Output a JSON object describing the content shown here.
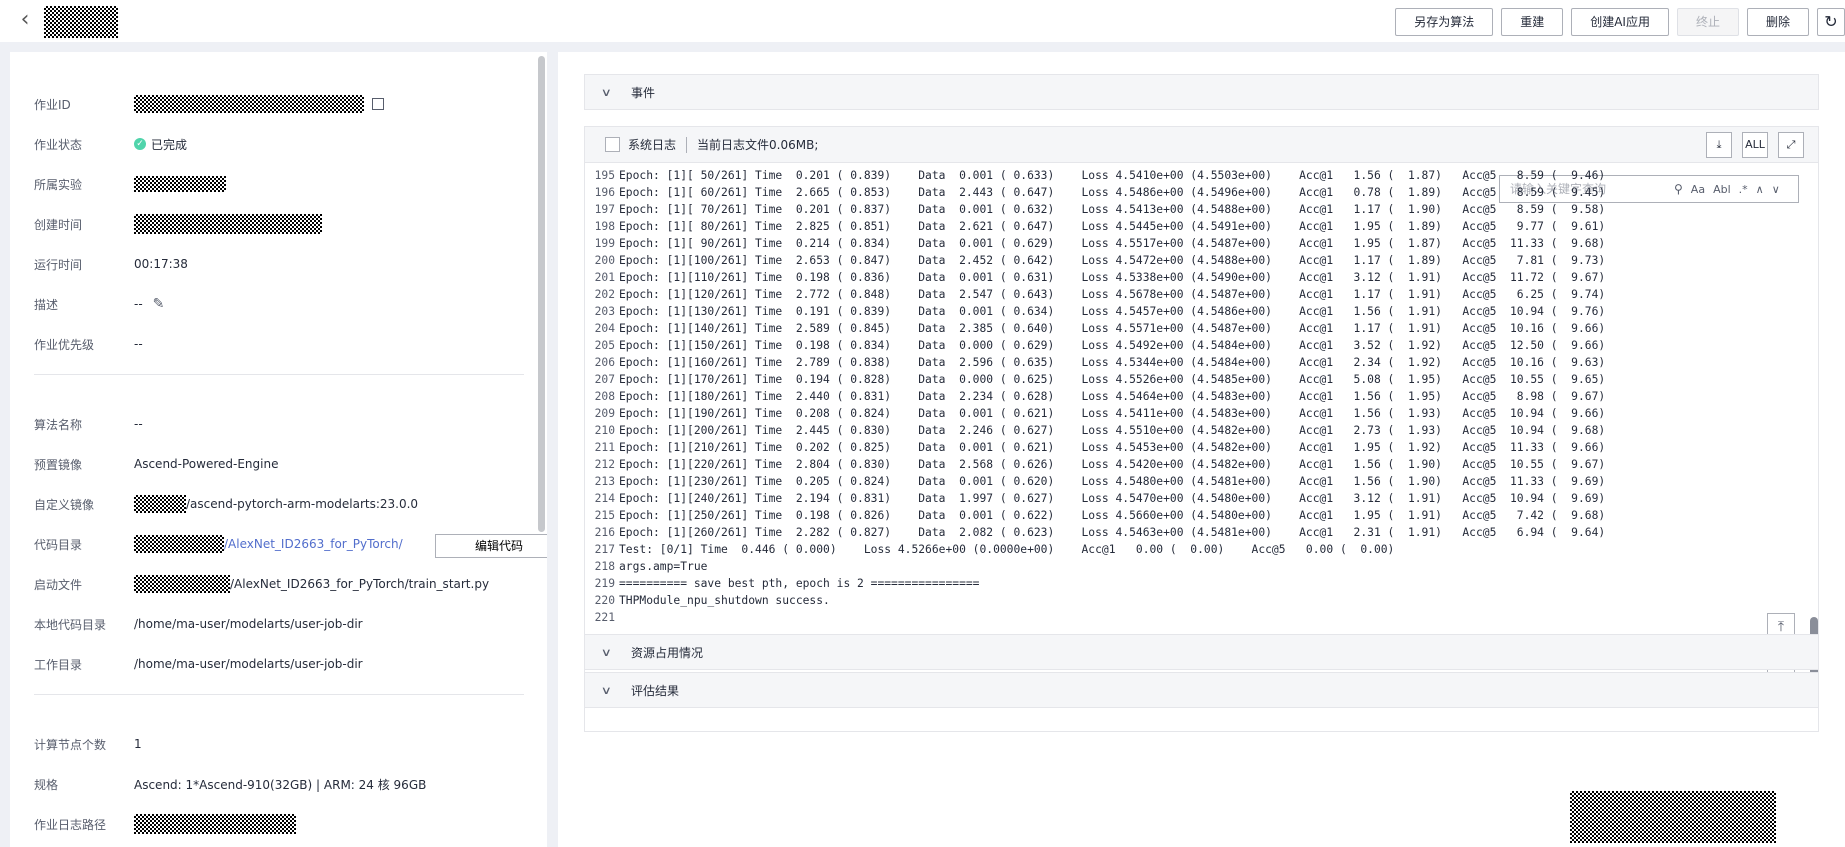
{
  "header": {
    "back_icon": "chevron-left-icon",
    "actions": {
      "save_as_algorithm": "另存为算法",
      "rebuild": "重建",
      "create_ai_app": "创建AI应用",
      "terminate": "终止",
      "delete": "删除",
      "refresh_icon": "refresh-icon"
    }
  },
  "job_info": {
    "job_id": {
      "label": "作业ID"
    },
    "status": {
      "label": "作业状态",
      "value": "已完成",
      "color": "#50d4ab"
    },
    "experiment": {
      "label": "所属实验"
    },
    "created_time": {
      "label": "创建时间"
    },
    "run_time": {
      "label": "运行时间",
      "value": "00:17:38"
    },
    "description": {
      "label": "描述",
      "value": "--"
    },
    "priority": {
      "label": "作业优先级",
      "value": "--"
    },
    "algorithm_name": {
      "label": "算法名称",
      "value": "--"
    },
    "preset_image": {
      "label": "预置镜像",
      "value": "Ascend-Powered-Engine"
    },
    "custom_image": {
      "label": "自定义镜像",
      "value": "/ascend-pytorch-arm-modelarts:23.0.0"
    },
    "code_dir": {
      "label": "代码目录",
      "value": "/AlexNet_ID2663_for_PyTorch/",
      "edit_button": "编辑代码"
    },
    "boot_file": {
      "label": "启动文件",
      "value": "/AlexNet_ID2663_for_PyTorch/train_start.py"
    },
    "local_code_dir": {
      "label": "本地代码目录",
      "value": "/home/ma-user/modelarts/user-job-dir"
    },
    "work_dir": {
      "label": "工作目录",
      "value": "/home/ma-user/modelarts/user-job-dir"
    },
    "node_count": {
      "label": "计算节点个数",
      "value": "1"
    },
    "spec": {
      "label": "规格",
      "value": "Ascend: 1*Ascend-910(32GB) | ARM: 24 核 96GB"
    },
    "log_path": {
      "label": "作业日志路径"
    }
  },
  "sections": {
    "events": "事件",
    "resources": "资源占用情况",
    "evaluation": "评估结果"
  },
  "log_panel": {
    "system_log_label": "系统日志",
    "file_size_text": "当前日志文件0.06MB;",
    "download_icon": "download-icon",
    "all_label": "ALL",
    "expand_icon": "expand-icon",
    "search_placeholder": "请输入关键字查询",
    "search_opt_case": "Aa",
    "search_opt_word": "Abl",
    "search_opt_regex": ".*",
    "prev_icon": "chevron-up-icon",
    "next_icon": "chevron-down-icon",
    "lines": [
      {
        "n": "195",
        "t": "Epoch: [1][ 50/261] Time  0.201 ( 0.839)    Data  0.001 ( 0.633)    Loss 4.5410e+00 (4.5503e+00)    Acc@1   1.56 (  1.87)   Acc@5   8.59 (  9.46)"
      },
      {
        "n": "196",
        "t": "Epoch: [1][ 60/261] Time  2.665 ( 0.853)    Data  2.443 ( 0.647)    Loss 4.5486e+00 (4.5496e+00)    Acc@1   0.78 (  1.89)   Acc@5   8.59 (  9.45)"
      },
      {
        "n": "197",
        "t": "Epoch: [1][ 70/261] Time  0.201 ( 0.837)    Data  0.001 ( 0.632)    Loss 4.5413e+00 (4.5488e+00)    Acc@1   1.17 (  1.90)   Acc@5   8.59 (  9.58)"
      },
      {
        "n": "198",
        "t": "Epoch: [1][ 80/261] Time  2.825 ( 0.851)    Data  2.621 ( 0.647)    Loss 4.5445e+00 (4.5491e+00)    Acc@1   1.95 (  1.89)   Acc@5   9.77 (  9.61)"
      },
      {
        "n": "199",
        "t": "Epoch: [1][ 90/261] Time  0.214 ( 0.834)    Data  0.001 ( 0.629)    Loss 4.5517e+00 (4.5487e+00)    Acc@1   1.95 (  1.87)   Acc@5  11.33 (  9.68)"
      },
      {
        "n": "200",
        "t": "Epoch: [1][100/261] Time  2.653 ( 0.847)    Data  2.452 ( 0.642)    Loss 4.5472e+00 (4.5488e+00)    Acc@1   1.17 (  1.89)   Acc@5   7.81 (  9.73)"
      },
      {
        "n": "201",
        "t": "Epoch: [1][110/261] Time  0.198 ( 0.836)    Data  0.001 ( 0.631)    Loss 4.5338e+00 (4.5490e+00)    Acc@1   3.12 (  1.91)   Acc@5  11.72 (  9.67)"
      },
      {
        "n": "202",
        "t": "Epoch: [1][120/261] Time  2.772 ( 0.848)    Data  2.547 ( 0.643)    Loss 4.5678e+00 (4.5487e+00)    Acc@1   1.17 (  1.91)   Acc@5   6.25 (  9.74)"
      },
      {
        "n": "203",
        "t": "Epoch: [1][130/261] Time  0.191 ( 0.839)    Data  0.001 ( 0.634)    Loss 4.5457e+00 (4.5486e+00)    Acc@1   1.56 (  1.91)   Acc@5  10.94 (  9.76)"
      },
      {
        "n": "204",
        "t": "Epoch: [1][140/261] Time  2.589 ( 0.845)    Data  2.385 ( 0.640)    Loss 4.5571e+00 (4.5487e+00)    Acc@1   1.17 (  1.91)   Acc@5  10.16 (  9.66)"
      },
      {
        "n": "205",
        "t": "Epoch: [1][150/261] Time  0.198 ( 0.834)    Data  0.000 ( 0.629)    Loss 4.5492e+00 (4.5484e+00)    Acc@1   3.52 (  1.92)   Acc@5  12.50 (  9.66)"
      },
      {
        "n": "206",
        "t": "Epoch: [1][160/261] Time  2.789 ( 0.838)    Data  2.596 ( 0.635)    Loss 4.5344e+00 (4.5484e+00)    Acc@1   2.34 (  1.92)   Acc@5  10.16 (  9.63)"
      },
      {
        "n": "207",
        "t": "Epoch: [1][170/261] Time  0.194 ( 0.828)    Data  0.000 ( 0.625)    Loss 4.5526e+00 (4.5485e+00)    Acc@1   5.08 (  1.95)   Acc@5  10.55 (  9.65)"
      },
      {
        "n": "208",
        "t": "Epoch: [1][180/261] Time  2.440 ( 0.831)    Data  2.234 ( 0.628)    Loss 4.5464e+00 (4.5483e+00)    Acc@1   1.56 (  1.95)   Acc@5   8.98 (  9.67)"
      },
      {
        "n": "209",
        "t": "Epoch: [1][190/261] Time  0.208 ( 0.824)    Data  0.001 ( 0.621)    Loss 4.5411e+00 (4.5483e+00)    Acc@1   1.56 (  1.93)   Acc@5  10.94 (  9.66)"
      },
      {
        "n": "210",
        "t": "Epoch: [1][200/261] Time  2.445 ( 0.830)    Data  2.246 ( 0.627)    Loss 4.5510e+00 (4.5482e+00)    Acc@1   2.73 (  1.93)   Acc@5  10.94 (  9.68)"
      },
      {
        "n": "211",
        "t": "Epoch: [1][210/261] Time  0.202 ( 0.825)    Data  0.001 ( 0.621)    Loss 4.5453e+00 (4.5482e+00)    Acc@1   1.95 (  1.92)   Acc@5  11.33 (  9.66)"
      },
      {
        "n": "212",
        "t": "Epoch: [1][220/261] Time  2.804 ( 0.830)    Data  2.568 ( 0.626)    Loss 4.5420e+00 (4.5482e+00)    Acc@1   1.56 (  1.90)   Acc@5  10.55 (  9.67)"
      },
      {
        "n": "213",
        "t": "Epoch: [1][230/261] Time  0.205 ( 0.824)    Data  0.001 ( 0.620)    Loss 4.5480e+00 (4.5481e+00)    Acc@1   1.56 (  1.90)   Acc@5  11.33 (  9.69)"
      },
      {
        "n": "214",
        "t": "Epoch: [1][240/261] Time  2.194 ( 0.831)    Data  1.997 ( 0.627)    Loss 4.5470e+00 (4.5480e+00)    Acc@1   3.12 (  1.91)   Acc@5  10.94 (  9.69)"
      },
      {
        "n": "215",
        "t": "Epoch: [1][250/261] Time  0.198 ( 0.826)    Data  0.001 ( 0.622)    Loss 4.5660e+00 (4.5480e+00)    Acc@1   1.95 (  1.91)   Acc@5   7.42 (  9.68)"
      },
      {
        "n": "216",
        "t": "Epoch: [1][260/261] Time  2.282 ( 0.827)    Data  2.082 ( 0.623)    Loss 4.5463e+00 (4.5481e+00)    Acc@1   2.31 (  1.91)   Acc@5   6.94 (  9.64)"
      },
      {
        "n": "217",
        "t": "Test: [0/1] Time  0.446 ( 0.000)    Loss 4.5266e+00 (0.0000e+00)    Acc@1   0.00 (  0.00)    Acc@5   0.00 (  0.00)"
      },
      {
        "n": "218",
        "t": "args.amp=True"
      },
      {
        "n": "219",
        "t": "========== save best pth, epoch is 2 ================"
      },
      {
        "n": "220",
        "t": "THPModule_npu_shutdown success."
      },
      {
        "n": "221",
        "t": ""
      }
    ]
  }
}
